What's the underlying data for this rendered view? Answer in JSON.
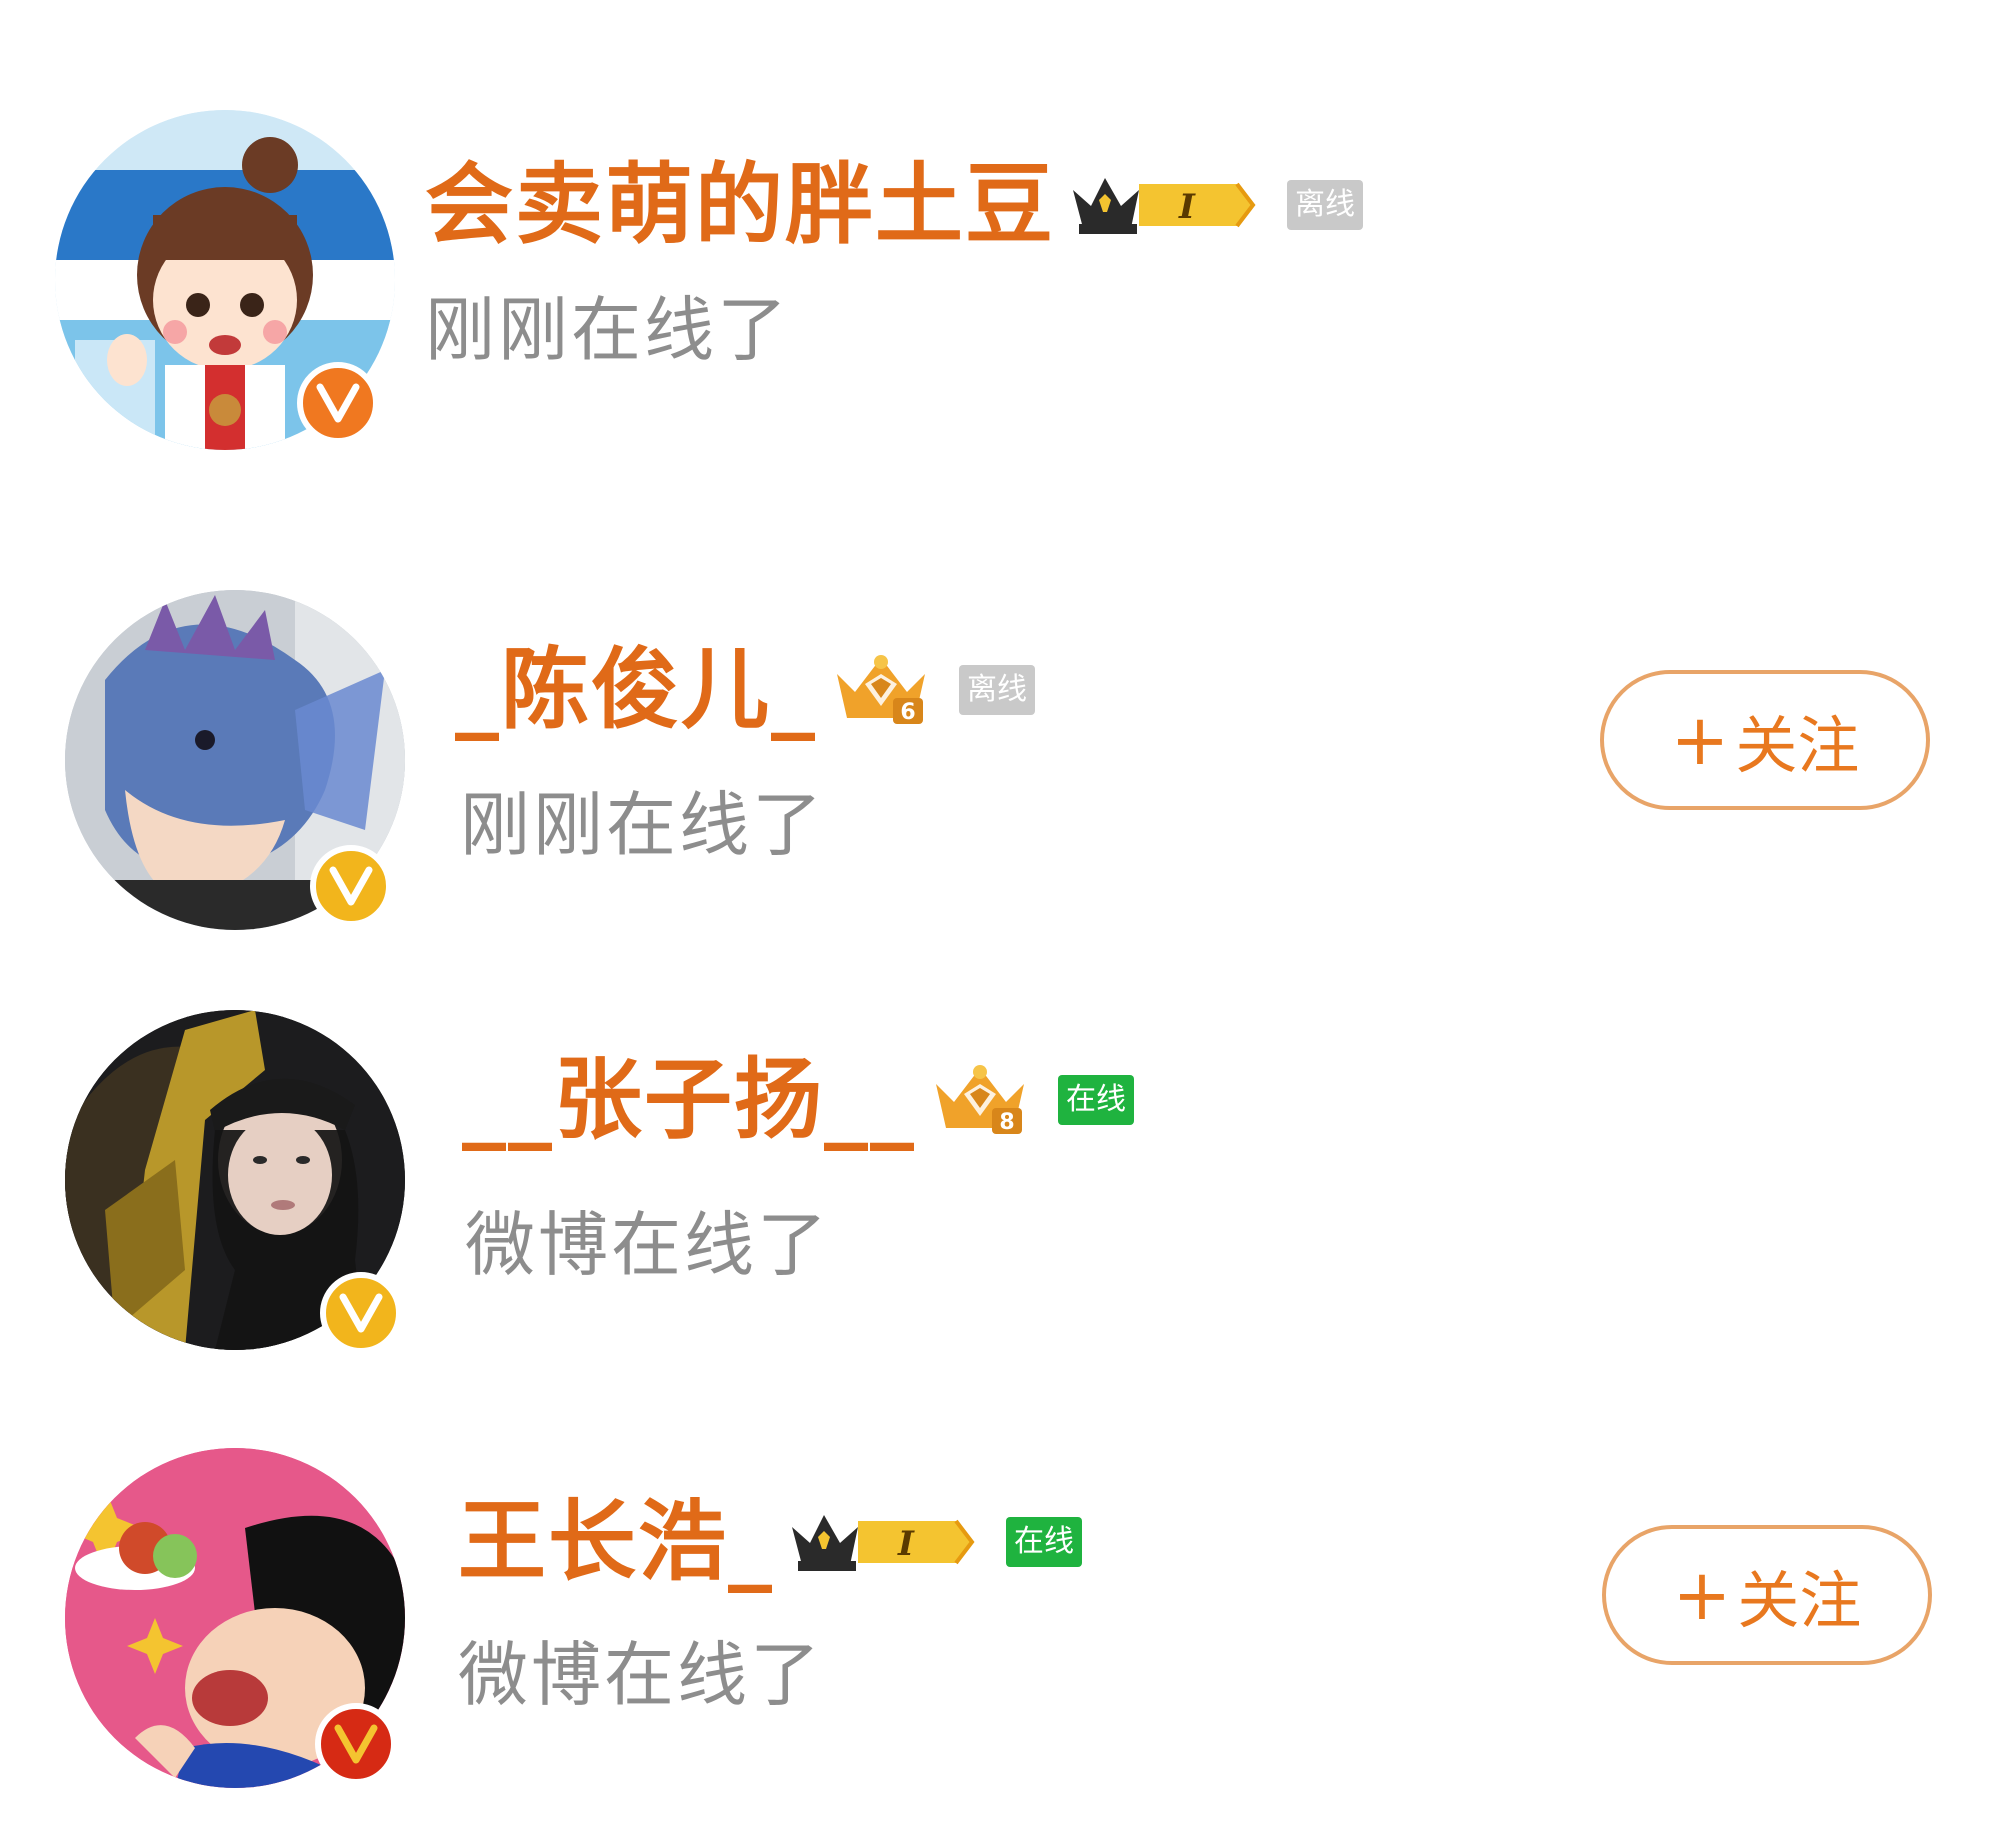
{
  "users": [
    {
      "name": "会卖萌的胖土豆",
      "status_tag": "离线",
      "status_type": "offline",
      "activity": "刚刚在线了",
      "badge_type": "crown-level",
      "badge_level": "I",
      "verified_color": "#f07820",
      "avatar_icon": "cartoon-girl-avatar",
      "follow_label": null
    },
    {
      "name": "_陈俊儿_",
      "status_tag": "离线",
      "status_type": "offline",
      "activity": "刚刚在线了",
      "badge_type": "diamond-crown",
      "badge_level": "6",
      "verified_color": "#f2b51c",
      "avatar_icon": "dragon-avatar",
      "follow_label": "关注"
    },
    {
      "name": "__张子扬__",
      "status_tag": "在线",
      "status_type": "online",
      "activity": "微博在线了",
      "badge_type": "diamond-crown",
      "badge_level": "8",
      "verified_color": "#f2b51c",
      "avatar_icon": "photo-person-avatar",
      "follow_label": null
    },
    {
      "name": "王长浩_",
      "status_tag": "在线",
      "status_type": "online",
      "activity": "微博在线了",
      "badge_type": "crown-level",
      "badge_level": "I",
      "verified_color": "#d62a14",
      "avatar_icon": "cartoon-boy-avatar",
      "follow_label": "关注"
    }
  ],
  "follow_plus": "+",
  "colors": {
    "name": "#e06a18",
    "activity": "#8d8d8d",
    "follow_border": "#e8a468",
    "follow_text": "#e8781f",
    "online": "#1fb33f",
    "offline": "#c9c9c9"
  }
}
